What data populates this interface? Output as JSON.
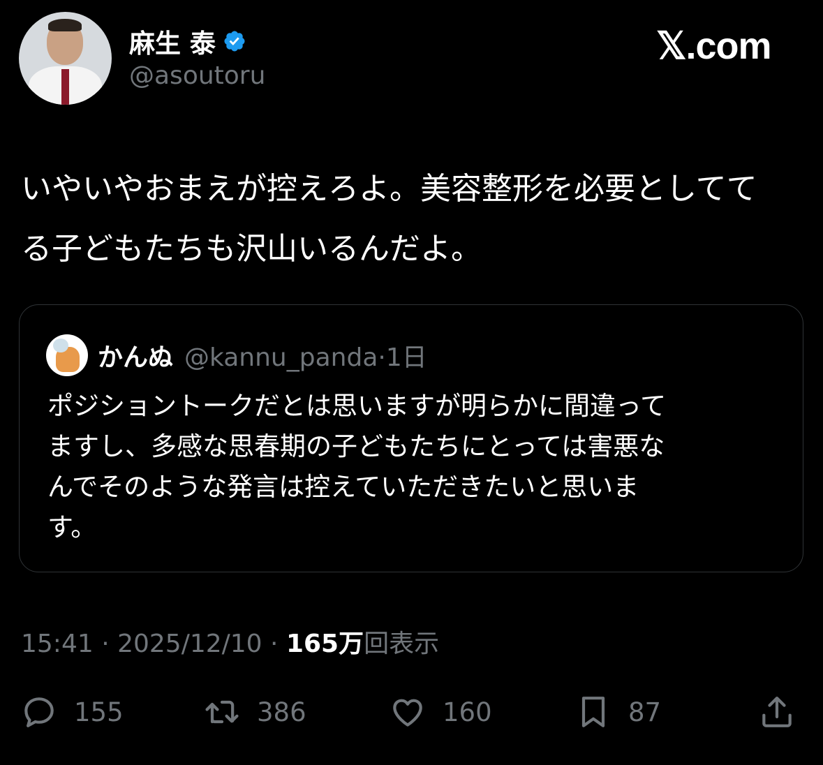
{
  "author": {
    "name": "麻生 泰",
    "handle": "@asoutoru",
    "verified": true
  },
  "brand": "𝕏.com",
  "tweet": {
    "lines": [
      "いやいやおまえが控えろよ。美容整形を必要としてて",
      "る子どもたちも沢山いるんだよ。"
    ]
  },
  "quoted": {
    "name": "かんぬ",
    "handle": "@kannu_panda",
    "sep": "·",
    "time": "1日",
    "lines": [
      "ポジショントークだとは思いますが明らかに間違って",
      "ますし、多感な思春期の子どもたちにとっては害悪な",
      "んでそのような発言は控えていただきたいと思いま",
      "す。"
    ]
  },
  "meta": {
    "time": "15:41",
    "sep1": " · ",
    "date": "2025/12/10",
    "sep2": " · ",
    "views": "165万",
    "views_label": "回表示"
  },
  "actions": {
    "replies": "155",
    "retweets": "386",
    "likes": "160",
    "bookmarks": "87"
  },
  "colors": {
    "background": "#000000",
    "text": "#ffffff",
    "muted": "#71767b",
    "verified": "#1d9bf0",
    "border": "#2f3336"
  }
}
